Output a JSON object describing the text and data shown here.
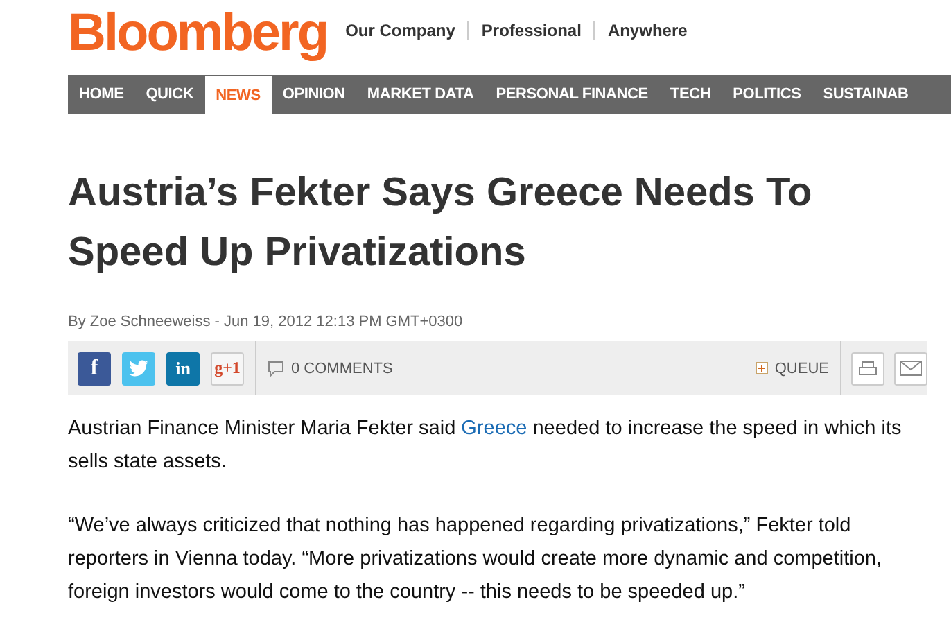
{
  "header": {
    "logo": "Bloomberg",
    "links": [
      "Our Company",
      "Professional",
      "Anywhere"
    ]
  },
  "nav": [
    {
      "label": "HOME",
      "selected": false
    },
    {
      "label": "QUICK",
      "selected": false
    },
    {
      "label": "NEWS",
      "selected": true
    },
    {
      "label": "OPINION",
      "selected": false
    },
    {
      "label": "MARKET DATA",
      "selected": false
    },
    {
      "label": "PERSONAL FINANCE",
      "selected": false
    },
    {
      "label": "TECH",
      "selected": false
    },
    {
      "label": "POLITICS",
      "selected": false
    },
    {
      "label": "SUSTAINAB",
      "selected": false
    }
  ],
  "article": {
    "title": "Austria’s Fekter Says Greece Needs To Speed Up Privatizations",
    "byline": "By Zoe Schneeweiss - Jun 19, 2012 12:13 PM GMT+0300",
    "share_bar": {
      "buttons": [
        {
          "kind": "facebook",
          "label": "f"
        },
        {
          "kind": "twitter"
        },
        {
          "kind": "linkedin",
          "label": "in"
        },
        {
          "kind": "googleplus",
          "label": "g+1"
        }
      ],
      "comments": "0 COMMENTS",
      "queue": "QUEUE",
      "tools": [
        {
          "kind": "print"
        },
        {
          "kind": "email"
        }
      ]
    },
    "paragraphs": [
      [
        {
          "text": "Austrian Finance Minister Maria Fekter said ",
          "link": false
        },
        {
          "text": "Greece",
          "link": true
        },
        {
          "text": " needed to increase the speed in which its sells state assets.",
          "link": false
        }
      ],
      [
        {
          "text": "“We’ve always criticized that nothing has happened regarding privatizations,” Fekter told reporters in Vienna today. “More privatizations would create more dynamic and competition, foreign investors would come to the country -- this needs to be speeded up.”",
          "link": false
        }
      ]
    ]
  }
}
